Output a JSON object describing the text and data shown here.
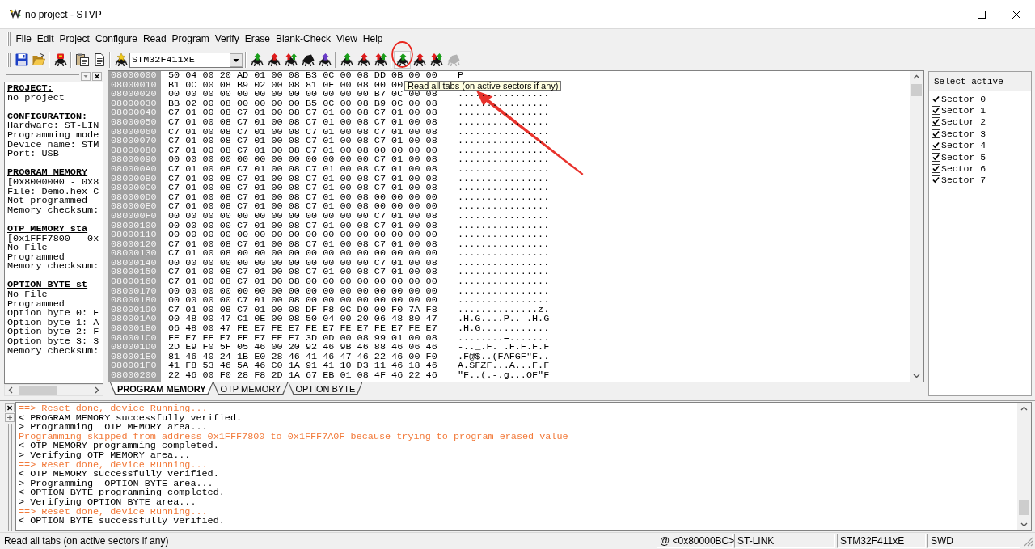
{
  "window": {
    "title": "no project - STVP"
  },
  "menu": [
    "File",
    "Edit",
    "Project",
    "Configure",
    "Read",
    "Program",
    "Verify",
    "Erase",
    "Blank-Check",
    "View",
    "Help"
  ],
  "toolbar": {
    "groups": [
      {
        "items": [
          {
            "kind": "save",
            "disabled": false,
            "circled": false
          },
          {
            "kind": "open",
            "disabled": false,
            "circled": false
          }
        ]
      },
      {
        "items": [
          {
            "kind": "chip-badge",
            "disabled": false,
            "circled": false
          }
        ]
      },
      {
        "items": [
          {
            "kind": "clipboard",
            "disabled": false,
            "circled": false
          },
          {
            "kind": "document",
            "disabled": false,
            "circled": false
          }
        ]
      },
      {
        "items": [
          {
            "kind": "chip-spark",
            "disabled": false,
            "circled": false
          },
          {
            "kind": "combo",
            "value": "STM32F411xE"
          }
        ]
      },
      {
        "items": [
          {
            "kind": "chip",
            "color": "#1a9e1a",
            "disabled": false,
            "circled": false
          },
          {
            "kind": "chip",
            "color": "#e01b1b",
            "disabled": false,
            "circled": false
          },
          {
            "kind": "chip-dual",
            "disabled": false,
            "circled": false
          },
          {
            "kind": "chip-plain",
            "disabled": false,
            "circled": false
          },
          {
            "kind": "chip",
            "color": "#6a3cc8",
            "disabled": false,
            "circled": false
          }
        ]
      },
      {
        "items": [
          {
            "kind": "chip",
            "color": "#1a9e1a",
            "disabled": false,
            "circled": false
          },
          {
            "kind": "chip",
            "color": "#e01b1b",
            "disabled": false,
            "circled": false
          },
          {
            "kind": "chip-dual",
            "disabled": false,
            "circled": false
          }
        ]
      },
      {
        "items": [
          {
            "kind": "chip",
            "color": "#1a9e1a",
            "disabled": false,
            "circled": true
          },
          {
            "kind": "chip",
            "color": "#e01b1b",
            "disabled": false,
            "circled": false
          },
          {
            "kind": "chip-dual",
            "disabled": false,
            "circled": false
          },
          {
            "kind": "chip-plain",
            "disabled": true,
            "circled": false
          }
        ]
      }
    ]
  },
  "project_panel": {
    "sections": [
      {
        "heading": "PROJECT:",
        "lines": [
          "no project"
        ]
      },
      {
        "heading": "CONFIGURATION:",
        "lines": [
          "Hardware: ST-LIN",
          "Programming mode",
          "Device name: STM",
          "Port: USB"
        ]
      },
      {
        "heading": "PROGRAM MEMORY",
        "lines": [
          "[0x8000000 - 0x8",
          "File: Demo.hex C",
          "Not programmed",
          "Memory checksum:"
        ]
      },
      {
        "heading": "OTP MEMORY sta",
        "lines": [
          "[0x1FFF7800 - 0x",
          "No File",
          "Programmed",
          "Memory checksum:"
        ]
      },
      {
        "heading": "OPTION BYTE st",
        "lines": [
          "No File",
          "Programmed",
          "Option byte 0: E",
          "Option byte 1: A",
          "Option byte 2: F",
          "Option byte 3: 3",
          "Memory checksum:"
        ]
      }
    ]
  },
  "hex_view": {
    "rows": [
      {
        "address": "08000000",
        "bytes": "50 04 00 20 AD 01 00 08 B3 0C 00 08 DD 0B 00 00",
        "ascii": "P"
      },
      {
        "address": "08000010",
        "bytes": "B1 0C 00 08 B9 02 00 08 81 0E 00 08 00 00"
      },
      {
        "address": "08000020",
        "bytes": "00 00 00 00 00 00 00 00 00 00 00 00 B7 0C 00 08",
        "ascii": "................"
      },
      {
        "address": "08000030",
        "bytes": "BB 02 00 08 00 00 00 00 B5 0C 00 08 B9 0C 00 08",
        "ascii": "................"
      },
      {
        "address": "08000040",
        "bytes": "C7 01 00 08 C7 01 00 08 C7 01 00 08 C7 01 00 08",
        "ascii": "................"
      },
      {
        "address": "08000050",
        "bytes": "C7 01 00 08 C7 01 00 08 C7 01 00 08 C7 01 00 08",
        "ascii": "................"
      },
      {
        "address": "08000060",
        "bytes": "C7 01 00 08 C7 01 00 08 C7 01 00 08 C7 01 00 08",
        "ascii": "................"
      },
      {
        "address": "08000070",
        "bytes": "C7 01 00 08 C7 01 00 08 C7 01 00 08 C7 01 00 08",
        "ascii": "................"
      },
      {
        "address": "08000080",
        "bytes": "C7 01 00 08 C7 01 00 08 C7 01 00 08 00 00 00 00",
        "ascii": "................"
      },
      {
        "address": "08000090",
        "bytes": "00 00 00 00 00 00 00 00 00 00 00 00 C7 01 00 08",
        "ascii": "................"
      },
      {
        "address": "080000A0",
        "bytes": "C7 01 00 08 C7 01 00 08 C7 01 00 08 C7 01 00 08",
        "ascii": "................"
      },
      {
        "address": "080000B0",
        "bytes": "C7 01 00 08 C7 01 00 08 C7 01 00 08 C7 01 00 08",
        "ascii": "................"
      },
      {
        "address": "080000C0",
        "bytes": "C7 01 00 08 C7 01 00 08 C7 01 00 08 C7 01 00 08",
        "ascii": "................"
      },
      {
        "address": "080000D0",
        "bytes": "C7 01 00 08 C7 01 00 08 C7 01 00 08 00 00 00 00",
        "ascii": "................"
      },
      {
        "address": "080000E0",
        "bytes": "C7 01 00 08 C7 01 00 08 C7 01 00 08 00 00 00 00",
        "ascii": "................"
      },
      {
        "address": "080000F0",
        "bytes": "00 00 00 00 00 00 00 00 00 00 00 00 C7 01 00 08",
        "ascii": "................"
      },
      {
        "address": "08000100",
        "bytes": "00 00 00 00 C7 01 00 08 C7 01 00 08 C7 01 00 08",
        "ascii": "................"
      },
      {
        "address": "08000110",
        "bytes": "00 00 00 00 00 00 00 00 00 00 00 00 00 00 00 00",
        "ascii": "................"
      },
      {
        "address": "08000120",
        "bytes": "C7 01 00 08 C7 01 00 08 C7 01 00 08 C7 01 00 08",
        "ascii": "................"
      },
      {
        "address": "08000130",
        "bytes": "C7 01 00 08 00 00 00 00 00 00 00 00 00 00 00 00",
        "ascii": "................"
      },
      {
        "address": "08000140",
        "bytes": "00 00 00 00 00 00 00 00 00 00 00 00 C7 01 00 08",
        "ascii": "................"
      },
      {
        "address": "08000150",
        "bytes": "C7 01 00 08 C7 01 00 08 C7 01 00 08 C7 01 00 08",
        "ascii": "................"
      },
      {
        "address": "08000160",
        "bytes": "C7 01 00 08 C7 01 00 08 00 00 00 00 00 00 00 00",
        "ascii": "................"
      },
      {
        "address": "08000170",
        "bytes": "00 00 00 00 00 00 00 00 00 00 00 00 00 00 00 00",
        "ascii": "................"
      },
      {
        "address": "08000180",
        "bytes": "00 00 00 00 C7 01 00 08 00 00 00 00 00 00 00 00",
        "ascii": "................"
      },
      {
        "address": "08000190",
        "bytes": "C7 01 00 08 C7 01 00 08 DF F8 0C D0 00 F0 7A F8",
        "ascii": "..............z."
      },
      {
        "address": "080001A0",
        "bytes": "00 48 00 47 C1 0E 00 08 50 04 00 20 06 48 80 47",
        "ascii": ".H.G....P.. .H.G"
      },
      {
        "address": "080001B0",
        "bytes": "06 48 00 47 FE E7 FE E7 FE E7 FE E7 FE E7 FE E7",
        "ascii": ".H.G............"
      },
      {
        "address": "080001C0",
        "bytes": "FE E7 FE E7 FE E7 FE E7 3D 0D 00 08 99 01 00 08",
        "ascii": "........=......."
      },
      {
        "address": "080001D0",
        "bytes": "2D E9 F0 5F 05 46 00 20 92 46 9B 46 88 46 06 46",
        "ascii": "-.._.F. .F.F.F.F"
      },
      {
        "address": "080001E0",
        "bytes": "81 46 40 24 1B E0 28 46 41 46 47 46 22 46 00 F0",
        "ascii": ".F@$..(FAFGF\"F.."
      },
      {
        "address": "080001F0",
        "bytes": "41 F8 53 46 5A 46 C0 1A 91 41 10 D3 11 46 18 46",
        "ascii": "A.SFZF...A...F.F"
      },
      {
        "address": "08000200",
        "bytes": "22 46 00 F0 28 F8 2D 1A 67 EB 01 08 4F 46 22 46",
        "ascii": "\"F..(.-.g...OF\"F"
      }
    ]
  },
  "tooltip": {
    "text": "Read all tabs (on active sectors if any)",
    "pointer_arrow": true
  },
  "tabs": [
    {
      "label": "PROGRAM MEMORY",
      "selected": true
    },
    {
      "label": "OTP MEMORY",
      "selected": false
    },
    {
      "label": "OPTION BYTE",
      "selected": false
    }
  ],
  "sectors": {
    "header": "Select active",
    "items": [
      {
        "label": "Sector 0",
        "checked": true
      },
      {
        "label": "Sector 1",
        "checked": true
      },
      {
        "label": "Sector 2",
        "checked": true
      },
      {
        "label": "Sector 3",
        "checked": true
      },
      {
        "label": "Sector 4",
        "checked": true
      },
      {
        "label": "Sector 5",
        "checked": true
      },
      {
        "label": "Sector 6",
        "checked": true
      },
      {
        "label": "Sector 7",
        "checked": true
      }
    ]
  },
  "log": {
    "lines": [
      {
        "text": "==> Reset done, device Running...",
        "color": "#f27a3a"
      },
      {
        "text": "< PROGRAM MEMORY successfully verified.",
        "color": "#000000"
      },
      {
        "text": "> Programming  OTP MEMORY area...",
        "color": "#000000"
      },
      {
        "text": "Programming skipped from address 0x1FFF7800 to 0x1FFF7A0F because trying to program erased value",
        "color": "#f27a3a"
      },
      {
        "text": "< OTP MEMORY programming completed.",
        "color": "#000000"
      },
      {
        "text": "> Verifying OTP MEMORY area...",
        "color": "#000000"
      },
      {
        "text": "==> Reset done, device Running...",
        "color": "#f27a3a"
      },
      {
        "text": "< OTP MEMORY successfully verified.",
        "color": "#000000"
      },
      {
        "text": "> Programming  OPTION BYTE area...",
        "color": "#000000"
      },
      {
        "text": "< OPTION BYTE programming completed.",
        "color": "#000000"
      },
      {
        "text": "> Verifying OPTION BYTE area...",
        "color": "#000000"
      },
      {
        "text": "==> Reset done, device Running...",
        "color": "#f27a3a"
      },
      {
        "text": "< OPTION BYTE successfully verified.",
        "color": "#000000"
      }
    ]
  },
  "status_bar": {
    "message": "Read all tabs (on active sectors if any)",
    "fields": [
      "@ <0x80000BC>",
      "ST-LINK",
      "STM32F411xE",
      "SWD"
    ]
  }
}
